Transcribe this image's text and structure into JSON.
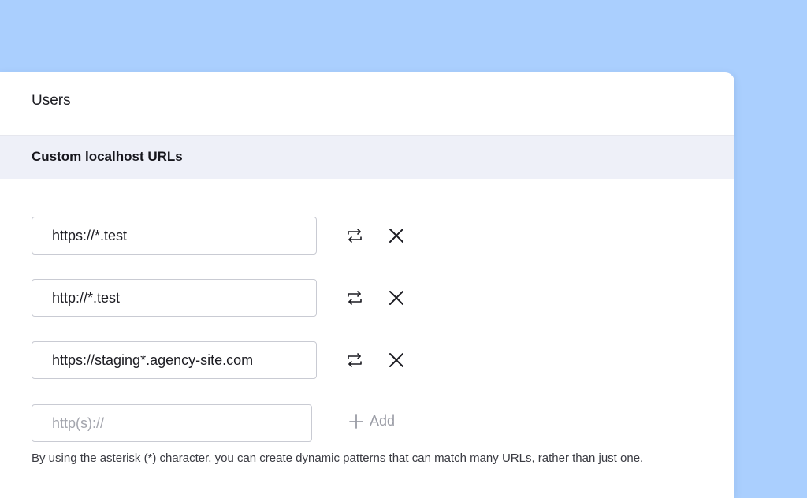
{
  "panel": {
    "title": "Users",
    "section_title": "Custom localhost URLs"
  },
  "urls": [
    {
      "value": "https://*.test",
      "swap_icon": "swap-arrows-icon",
      "remove_icon": "close-icon"
    },
    {
      "value": "http://*.test",
      "swap_icon": "swap-arrows-icon",
      "remove_icon": "close-icon"
    },
    {
      "value": "https://staging*.agency-site.com",
      "swap_icon": "swap-arrows-icon",
      "remove_icon": "close-icon"
    }
  ],
  "new_url": {
    "value": "",
    "placeholder": "http(s)://",
    "add_label": "Add",
    "add_icon": "plus-icon"
  },
  "hint": "By using the asterisk (*) character, you can create dynamic patterns that can match many URLs, rather than just one.",
  "colors": {
    "background": "#aacffe",
    "section_bar": "#eef0f8",
    "input_border": "#c9cbd3",
    "muted_text": "#9a9ca5"
  }
}
